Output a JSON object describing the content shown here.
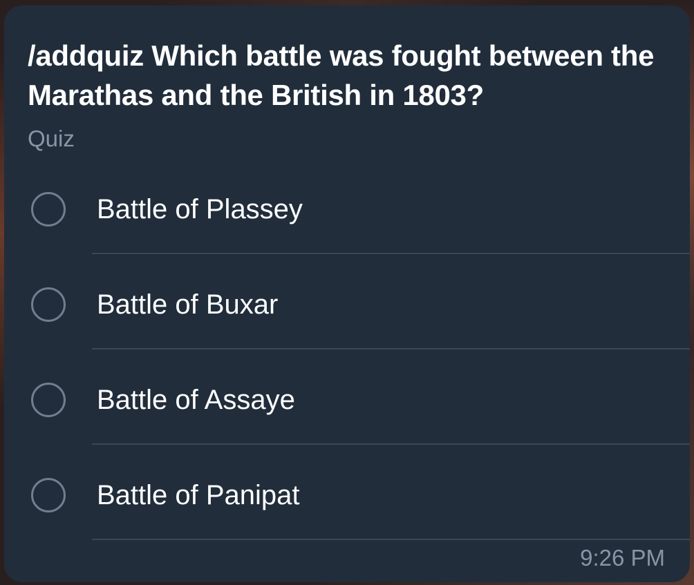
{
  "message": {
    "question": "/addquiz Which battle was fought between the Marathas and the British in 1803?",
    "type_label": "Quiz",
    "options": [
      {
        "label": "Battle of Plassey"
      },
      {
        "label": "Battle of Buxar"
      },
      {
        "label": "Battle of Assaye"
      },
      {
        "label": "Battle of Panipat"
      }
    ],
    "time": "9:26 PM"
  },
  "colors": {
    "bubble": "#212d3b",
    "text": "#ffffff",
    "muted": "#8796a6",
    "radio_border": "#6e7f91",
    "divider": "#3a4757"
  }
}
